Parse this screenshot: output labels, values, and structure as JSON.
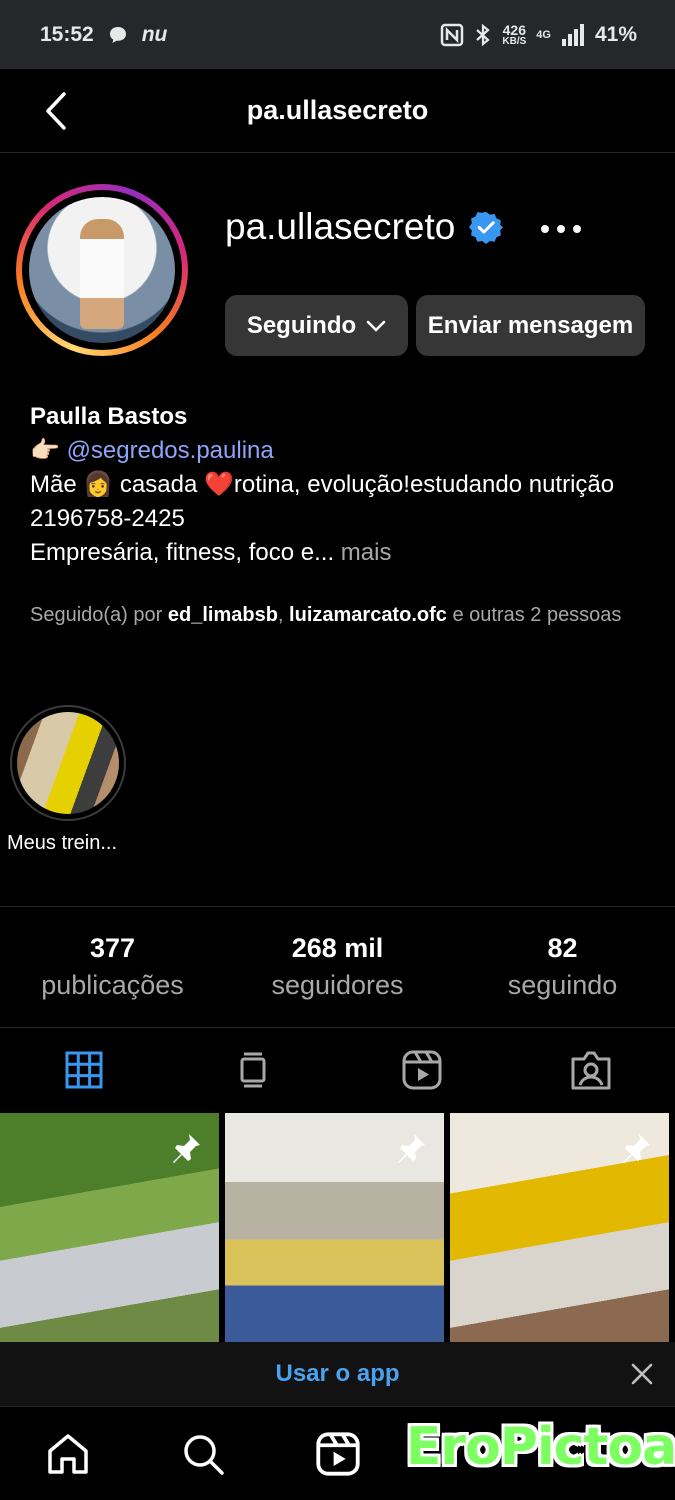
{
  "status_bar": {
    "time": "15:52",
    "carrier": "nu",
    "net_speed": "426",
    "net_unit": "KB/S",
    "network": "4G",
    "battery": "41%"
  },
  "header": {
    "title": "pa.ullasecreto"
  },
  "profile": {
    "username": "pa.ullasecreto",
    "follow_button": "Seguindo",
    "message_button": "Enviar mensagem",
    "name": "Paulla Bastos",
    "link_prefix": "👉🏻",
    "link": "@segredos.paulina",
    "bio_line1": "Mãe 👩 casada ❤️rotina, evolução!estudando nutrição 2196758-2425",
    "bio_line2": "Empresária, fitness, foco e...",
    "bio_more": "mais",
    "followed_prefix": "Seguido(a) por",
    "followed_user1": "ed_limabsb",
    "followed_sep": ",",
    "followed_user2": "luizamarcato.ofc",
    "followed_suffix": "e outras 2 pessoas"
  },
  "highlight": {
    "label": "Meus trein..."
  },
  "stats": [
    {
      "value": "377",
      "label": "publicações"
    },
    {
      "value": "268 mil",
      "label": "seguidores"
    },
    {
      "value": "82",
      "label": "seguindo"
    }
  ],
  "tabs": [
    "grid-icon",
    "feed-icon",
    "reels-icon",
    "tagged-icon"
  ],
  "accent_color": "#3897f0",
  "banner": {
    "text": "Usar o app"
  },
  "watermark": "EroPictoa"
}
